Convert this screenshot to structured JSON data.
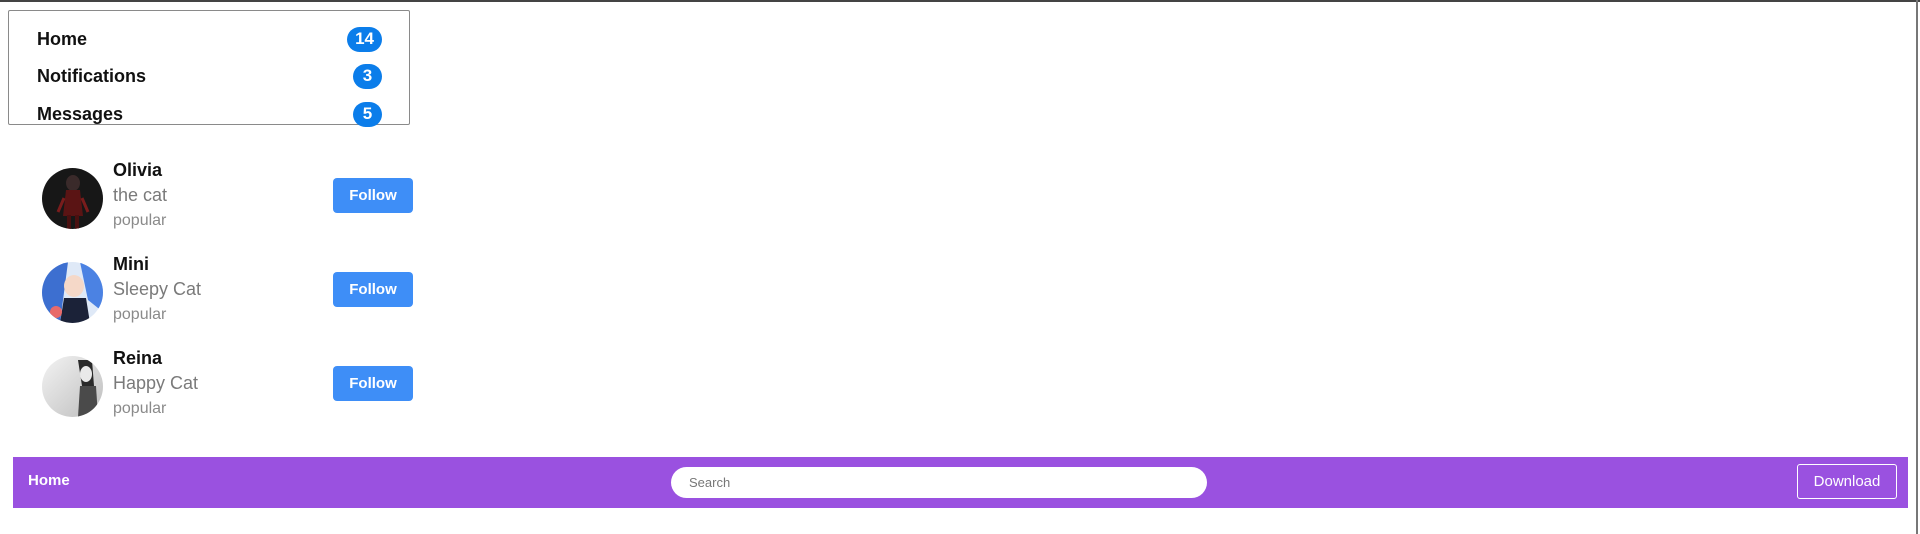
{
  "nav": {
    "items": [
      {
        "label": "Home",
        "count": "14"
      },
      {
        "label": "Notifications",
        "count": "3"
      },
      {
        "label": "Messages",
        "count": "5"
      }
    ]
  },
  "suggestions": [
    {
      "name": "Olivia",
      "subtitle": "the cat",
      "meta": "popular",
      "button": "Follow"
    },
    {
      "name": "Mini",
      "subtitle": "Sleepy Cat",
      "meta": "popular",
      "button": "Follow"
    },
    {
      "name": "Reina",
      "subtitle": "Happy Cat",
      "meta": "popular",
      "button": "Follow"
    }
  ],
  "appbar": {
    "brand": "Home",
    "search_placeholder": "Search",
    "search_value": "",
    "download_label": "Download",
    "background_color": "#9a51e0"
  },
  "colors": {
    "badge": "#0b7dea",
    "follow_button": "#3e8ef7"
  }
}
